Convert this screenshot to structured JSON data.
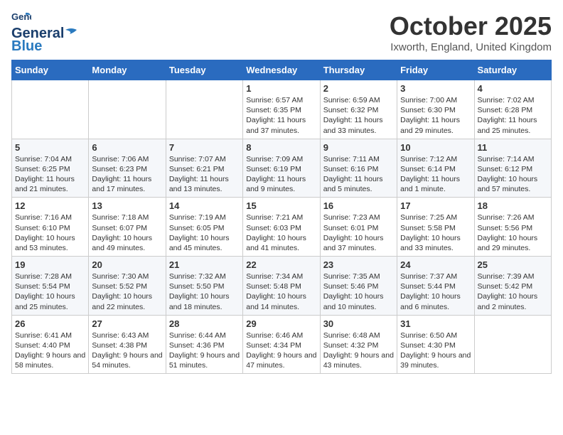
{
  "header": {
    "logo": {
      "general": "General",
      "blue": "Blue",
      "wing_color": "#2a7abf"
    },
    "title": "October 2025",
    "location": "Ixworth, England, United Kingdom"
  },
  "weekdays": [
    "Sunday",
    "Monday",
    "Tuesday",
    "Wednesday",
    "Thursday",
    "Friday",
    "Saturday"
  ],
  "weeks": [
    [
      {
        "day": "",
        "info": ""
      },
      {
        "day": "",
        "info": ""
      },
      {
        "day": "",
        "info": ""
      },
      {
        "day": "1",
        "info": "Sunrise: 6:57 AM\nSunset: 6:35 PM\nDaylight: 11 hours and 37 minutes."
      },
      {
        "day": "2",
        "info": "Sunrise: 6:59 AM\nSunset: 6:32 PM\nDaylight: 11 hours and 33 minutes."
      },
      {
        "day": "3",
        "info": "Sunrise: 7:00 AM\nSunset: 6:30 PM\nDaylight: 11 hours and 29 minutes."
      },
      {
        "day": "4",
        "info": "Sunrise: 7:02 AM\nSunset: 6:28 PM\nDaylight: 11 hours and 25 minutes."
      }
    ],
    [
      {
        "day": "5",
        "info": "Sunrise: 7:04 AM\nSunset: 6:25 PM\nDaylight: 11 hours and 21 minutes."
      },
      {
        "day": "6",
        "info": "Sunrise: 7:06 AM\nSunset: 6:23 PM\nDaylight: 11 hours and 17 minutes."
      },
      {
        "day": "7",
        "info": "Sunrise: 7:07 AM\nSunset: 6:21 PM\nDaylight: 11 hours and 13 minutes."
      },
      {
        "day": "8",
        "info": "Sunrise: 7:09 AM\nSunset: 6:19 PM\nDaylight: 11 hours and 9 minutes."
      },
      {
        "day": "9",
        "info": "Sunrise: 7:11 AM\nSunset: 6:16 PM\nDaylight: 11 hours and 5 minutes."
      },
      {
        "day": "10",
        "info": "Sunrise: 7:12 AM\nSunset: 6:14 PM\nDaylight: 11 hours and 1 minute."
      },
      {
        "day": "11",
        "info": "Sunrise: 7:14 AM\nSunset: 6:12 PM\nDaylight: 10 hours and 57 minutes."
      }
    ],
    [
      {
        "day": "12",
        "info": "Sunrise: 7:16 AM\nSunset: 6:10 PM\nDaylight: 10 hours and 53 minutes."
      },
      {
        "day": "13",
        "info": "Sunrise: 7:18 AM\nSunset: 6:07 PM\nDaylight: 10 hours and 49 minutes."
      },
      {
        "day": "14",
        "info": "Sunrise: 7:19 AM\nSunset: 6:05 PM\nDaylight: 10 hours and 45 minutes."
      },
      {
        "day": "15",
        "info": "Sunrise: 7:21 AM\nSunset: 6:03 PM\nDaylight: 10 hours and 41 minutes."
      },
      {
        "day": "16",
        "info": "Sunrise: 7:23 AM\nSunset: 6:01 PM\nDaylight: 10 hours and 37 minutes."
      },
      {
        "day": "17",
        "info": "Sunrise: 7:25 AM\nSunset: 5:58 PM\nDaylight: 10 hours and 33 minutes."
      },
      {
        "day": "18",
        "info": "Sunrise: 7:26 AM\nSunset: 5:56 PM\nDaylight: 10 hours and 29 minutes."
      }
    ],
    [
      {
        "day": "19",
        "info": "Sunrise: 7:28 AM\nSunset: 5:54 PM\nDaylight: 10 hours and 25 minutes."
      },
      {
        "day": "20",
        "info": "Sunrise: 7:30 AM\nSunset: 5:52 PM\nDaylight: 10 hours and 22 minutes."
      },
      {
        "day": "21",
        "info": "Sunrise: 7:32 AM\nSunset: 5:50 PM\nDaylight: 10 hours and 18 minutes."
      },
      {
        "day": "22",
        "info": "Sunrise: 7:34 AM\nSunset: 5:48 PM\nDaylight: 10 hours and 14 minutes."
      },
      {
        "day": "23",
        "info": "Sunrise: 7:35 AM\nSunset: 5:46 PM\nDaylight: 10 hours and 10 minutes."
      },
      {
        "day": "24",
        "info": "Sunrise: 7:37 AM\nSunset: 5:44 PM\nDaylight: 10 hours and 6 minutes."
      },
      {
        "day": "25",
        "info": "Sunrise: 7:39 AM\nSunset: 5:42 PM\nDaylight: 10 hours and 2 minutes."
      }
    ],
    [
      {
        "day": "26",
        "info": "Sunrise: 6:41 AM\nSunset: 4:40 PM\nDaylight: 9 hours and 58 minutes."
      },
      {
        "day": "27",
        "info": "Sunrise: 6:43 AM\nSunset: 4:38 PM\nDaylight: 9 hours and 54 minutes."
      },
      {
        "day": "28",
        "info": "Sunrise: 6:44 AM\nSunset: 4:36 PM\nDaylight: 9 hours and 51 minutes."
      },
      {
        "day": "29",
        "info": "Sunrise: 6:46 AM\nSunset: 4:34 PM\nDaylight: 9 hours and 47 minutes."
      },
      {
        "day": "30",
        "info": "Sunrise: 6:48 AM\nSunset: 4:32 PM\nDaylight: 9 hours and 43 minutes."
      },
      {
        "day": "31",
        "info": "Sunrise: 6:50 AM\nSunset: 4:30 PM\nDaylight: 9 hours and 39 minutes."
      },
      {
        "day": "",
        "info": ""
      }
    ]
  ]
}
